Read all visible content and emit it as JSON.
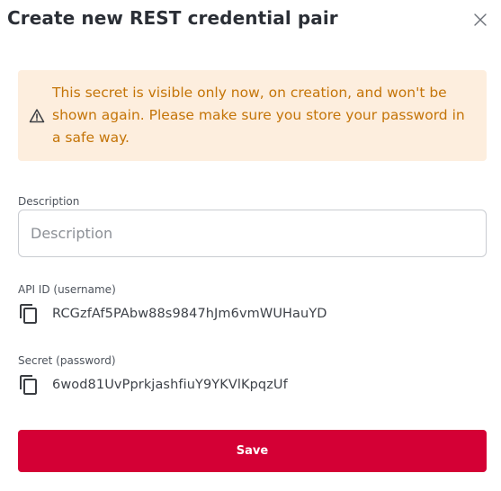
{
  "dialog": {
    "title": "Create new REST credential pair",
    "close_icon": "close-icon"
  },
  "alert": {
    "icon": "warning-icon",
    "message": "This secret is visible only now, on creation, and won't be shown again. Please make sure you store your password in a safe way.",
    "text_color": "#c47407",
    "background_color": "#fdeede"
  },
  "form": {
    "description": {
      "label": "Description",
      "placeholder": "Description",
      "value": ""
    },
    "api_id": {
      "label": "API ID (username)",
      "icon": "copy-icon",
      "value": "RCGzfAf5PAbw88s9847hJm6vmWUHauYD"
    },
    "secret": {
      "label": "Secret (password)",
      "icon": "copy-icon",
      "value": "6wod81UvPprkjashfiuY9YKVlKpqzUf"
    }
  },
  "actions": {
    "save_label": "Save",
    "save_color": "#d40035"
  }
}
